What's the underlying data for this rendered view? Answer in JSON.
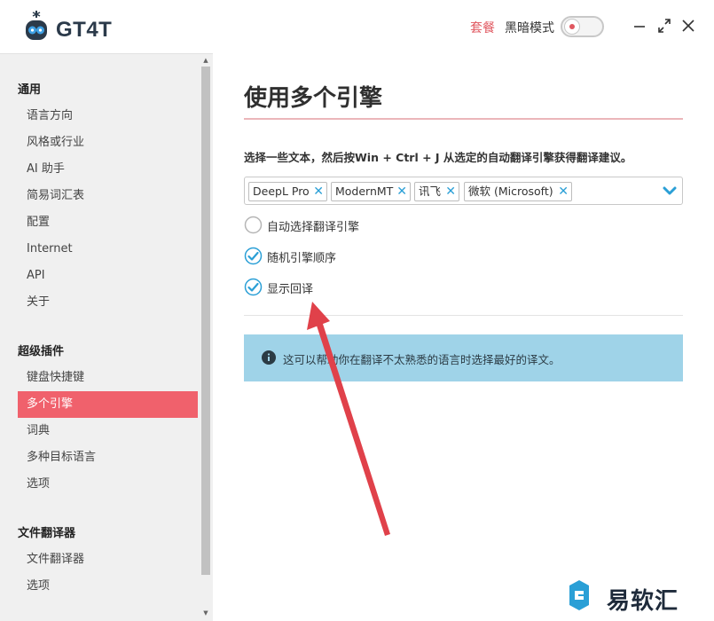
{
  "app": {
    "title": "GT4T",
    "logo_icon": "robot-logo-icon"
  },
  "header": {
    "plan_link": "套餐",
    "dark_mode_label": "黑暗模式",
    "dark_mode_on": false,
    "minimize_icon": "minimize-icon",
    "maximize_icon": "maximize-icon",
    "close_icon": "close-icon"
  },
  "sidebar": {
    "sections": [
      {
        "title": "通用",
        "items": [
          "语言方向",
          "风格或行业",
          "AI 助手",
          "简易词汇表",
          "配置",
          "Internet",
          "API",
          "关于"
        ]
      },
      {
        "title": "超级插件",
        "items": [
          "键盘快捷键",
          "多个引擎",
          "词典",
          "多种目标语言",
          "选项"
        ]
      },
      {
        "title": "文件翻译器",
        "items": [
          "文件翻译器",
          "选项"
        ]
      }
    ],
    "active_item": "多个引擎"
  },
  "main": {
    "page_title": "使用多个引擎",
    "description": "选择一些文本，然后按Win + Ctrl + J 从选定的自动翻译引擎获得翻译建议。",
    "selected_engines": [
      "DeepL Pro",
      "ModernMT",
      "讯飞",
      "微软 (Microsoft)"
    ],
    "options": [
      {
        "label": "自动选择翻译引擎",
        "checked": false
      },
      {
        "label": "随机引擎顺序",
        "checked": true
      },
      {
        "label": "显示回译",
        "checked": true
      }
    ],
    "info_text": "这可以帮助你在翻译不太熟悉的语言时选择最好的译文。",
    "info_icon": "info-icon"
  },
  "colors": {
    "accent": "#f0616c",
    "check_blue": "#2a9fd6",
    "info_bg": "#9fd3e8",
    "annotation_arrow": "#e0414a"
  },
  "watermark": {
    "text": "易软汇",
    "icon": "watermark-logo-icon"
  }
}
